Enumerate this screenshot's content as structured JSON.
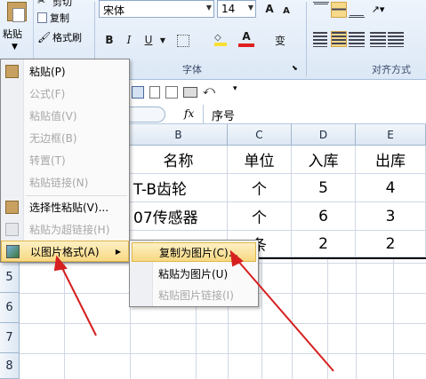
{
  "ribbon": {
    "paste_label": "粘贴",
    "cut_label": "剪切",
    "copy_label": "复制",
    "format_painter_label": "格式刷",
    "font_name": "宋体",
    "font_size": "14",
    "font_group_label": "字体",
    "align_group_label": "对齐方式",
    "bold": "B",
    "italic": "I",
    "underline": "U",
    "grow_font": "A",
    "shrink_font": "A",
    "font_color": "A",
    "phonetic": "变",
    "accent_color": "#f8d982",
    "font_color_value": "#e02020"
  },
  "formula_bar": {
    "fx_label": "fx",
    "value": "序号"
  },
  "columns": [
    "B",
    "C",
    "D",
    "E"
  ],
  "rows": [
    {
      "num": "",
      "cells": [
        "名称",
        "单位",
        "入库",
        "出库"
      ]
    },
    {
      "num": "",
      "cells": [
        "T-B齿轮",
        "个",
        "5",
        "4"
      ]
    },
    {
      "num": "",
      "cells": [
        "07传感器",
        "个",
        "6",
        "3"
      ]
    },
    {
      "num": "",
      "cells": [
        "",
        "条",
        "2",
        "2"
      ]
    },
    {
      "num": "5",
      "cells": [
        "",
        "",
        "",
        ""
      ]
    },
    {
      "num": "6",
      "cells": [
        "",
        "",
        "",
        ""
      ]
    },
    {
      "num": "7",
      "cells": [
        "",
        "",
        "",
        ""
      ]
    },
    {
      "num": "8",
      "cells": [
        "",
        "",
        "",
        ""
      ]
    }
  ],
  "context_menu": {
    "items": [
      {
        "label": "粘贴(P)",
        "enabled": true,
        "icon": "paste-icon"
      },
      {
        "label": "公式(F)",
        "enabled": false
      },
      {
        "label": "粘贴值(V)",
        "enabled": false
      },
      {
        "label": "无边框(B)",
        "enabled": false
      },
      {
        "label": "转置(T)",
        "enabled": false
      },
      {
        "label": "粘贴链接(N)",
        "enabled": false
      },
      {
        "label": "选择性粘贴(V)...",
        "enabled": true,
        "icon": "paste-special-icon"
      },
      {
        "label": "粘贴为超链接(H)",
        "enabled": false,
        "icon": "hyperlink-icon"
      },
      {
        "label": "以图片格式(A)",
        "enabled": true,
        "icon": "picture-icon",
        "submenu_arrow": "▶"
      }
    ]
  },
  "submenu": {
    "items": [
      {
        "label": "复制为图片(C)...",
        "enabled": true
      },
      {
        "label": "粘贴为图片(U)",
        "enabled": true
      },
      {
        "label": "粘贴图片链接(I)",
        "enabled": false
      }
    ]
  },
  "annotation_color": "#d62020"
}
